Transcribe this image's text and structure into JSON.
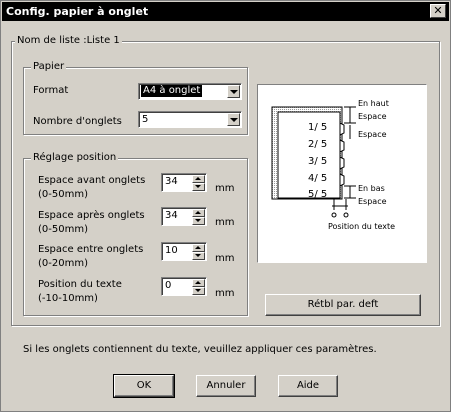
{
  "window": {
    "title": "Config. papier à onglet",
    "close_glyph": "✕"
  },
  "list_name": "Nom de liste :Liste 1",
  "paper": {
    "legend": "Papier",
    "format_label": "Format",
    "format_value": "A4 à onglet",
    "tabs_label": "Nombre d'onglets",
    "tabs_value": "5"
  },
  "position": {
    "legend": "Réglage position",
    "fields": [
      {
        "label": "Espace avant onglets",
        "range": "(0-50mm)",
        "value": "34",
        "unit": "mm"
      },
      {
        "label": "Espace après onglets",
        "range": "(0-50mm)",
        "value": "34",
        "unit": "mm"
      },
      {
        "label": "Espace entre onglets",
        "range": "(0-20mm)",
        "value": "10",
        "unit": "mm"
      },
      {
        "label": "Position du texte",
        "range": "(-10-10mm)",
        "value": "0",
        "unit": "mm"
      }
    ]
  },
  "preview": {
    "tabs": [
      "1/ 5",
      "2/ 5",
      "3/ 5",
      "4/ 5",
      "5/ 5"
    ],
    "top_label": "En haut",
    "space_label": "Espace",
    "space_between_label": "Espace",
    "bottom_label": "En bas",
    "bottom_space_label": "Espace",
    "text_pos_label": "Position du texte"
  },
  "reset_button": "Rétbl par. deft",
  "info_text": "Si les onglets contiennent du texte, veuillez appliquer ces paramètres.",
  "buttons": {
    "ok": "OK",
    "cancel": "Annuler",
    "help": "Aide"
  }
}
